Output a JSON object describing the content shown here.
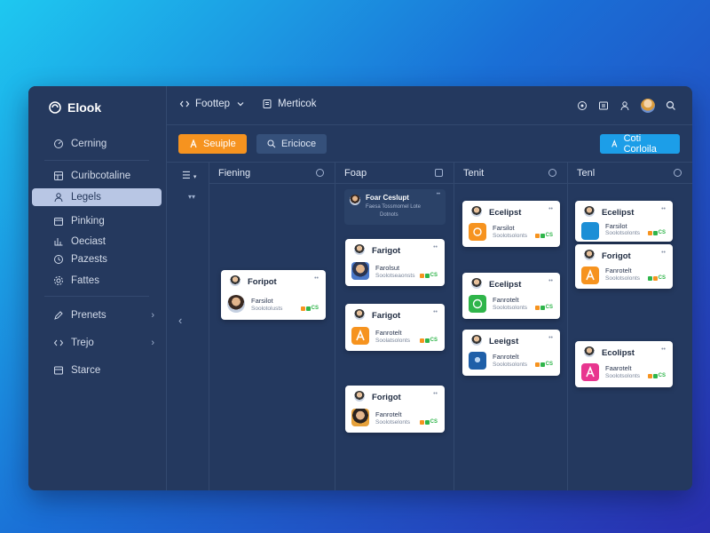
{
  "app": {
    "name": "Elook"
  },
  "header": {
    "project": "Foottep",
    "view": "Merticok"
  },
  "sidebar": {
    "items": [
      {
        "label": "Cerning"
      },
      {
        "label": "Curibcotaline"
      },
      {
        "label": "Legels"
      },
      {
        "label": "Pinking"
      },
      {
        "label": "Oeciast"
      },
      {
        "label": "Pazests"
      },
      {
        "label": "Fattes"
      },
      {
        "label": "Prenets"
      },
      {
        "label": "Trejo"
      },
      {
        "label": "Starce"
      }
    ]
  },
  "toolbar": {
    "primary": "Seuiple",
    "secondary": "Ericioce",
    "action": "Coti Corloila"
  },
  "board": {
    "columns": [
      {
        "title": "Fiening"
      },
      {
        "title": "Foap"
      },
      {
        "title": "Tenit"
      },
      {
        "title": "Tenl"
      }
    ],
    "featured": {
      "title": "Foar Ceslupt",
      "line1": "Faesa Tossmomel Lote",
      "line2": "Dotnots"
    },
    "cards": [
      {
        "title": "Foripot",
        "line1": "Farsilot",
        "line2": "Soolotolusts"
      },
      {
        "title": "Farigot",
        "line1": "Farolsut",
        "line2": "Soolotseaonsts"
      },
      {
        "title": "Farigot",
        "line1": "Fanrotelt",
        "line2": "Soolatsolonts"
      },
      {
        "title": "Forigot",
        "line1": "Fanrotelt",
        "line2": "Soolotselonts"
      },
      {
        "title": "Ecelipst",
        "line1": "Farsilot",
        "line2": "Soolotsolonts"
      },
      {
        "title": "Ecelipst",
        "line1": "Fanrotelt",
        "line2": "Soolotsolonts"
      },
      {
        "title": "Leeigst",
        "line1": "Fanrotelt",
        "line2": "Soolotsolonts"
      },
      {
        "title": "Ecelipst",
        "line1": "Farsilot",
        "line2": "Soolotsolonts"
      },
      {
        "title": "Forigot",
        "line1": "Fanrotelt",
        "line2": "Soolotsolonts"
      },
      {
        "title": "Ecolipst",
        "line1": "Faarotelt",
        "line2": "Soolotsolonts"
      }
    ]
  },
  "colors": {
    "accent_orange": "#f6931f",
    "accent_blue": "#1c9ee8",
    "panel": "#24395f"
  }
}
